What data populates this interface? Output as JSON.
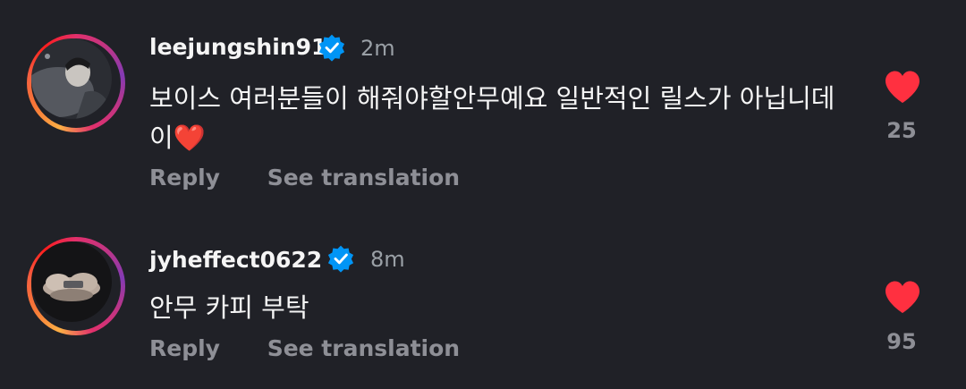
{
  "comments": [
    {
      "username": "leejungshin91",
      "verified": true,
      "time": "2m",
      "text": "보이스 여러분들이 해줘야할안무예요 일반적인 릴스가 아닙니데이",
      "emoji": "❤️",
      "reply_label": "Reply",
      "translate_label": "See translation",
      "like_count": "25",
      "avatar_icon": "profile-photo-icon"
    },
    {
      "username": "jyheffect0622",
      "verified": true,
      "time": "8m",
      "text": "안무 카피 부탁",
      "reply_label": "Reply",
      "translate_label": "See translation",
      "like_count": "95",
      "avatar_icon": "profile-photo-icon"
    }
  ],
  "colors": {
    "background": "#202127",
    "verified_badge": "#0095f6",
    "like_heart": "#ff3040",
    "secondary_text": "#8e8f96"
  }
}
